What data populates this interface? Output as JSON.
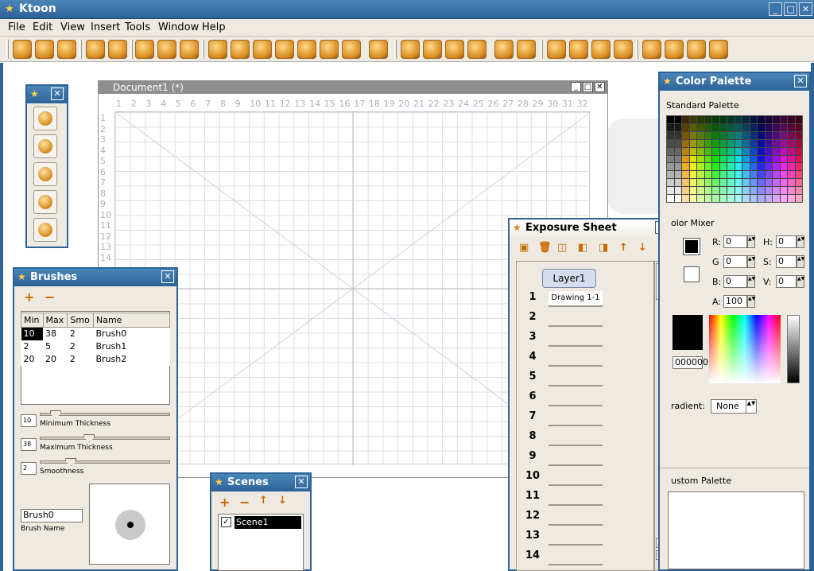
{
  "app": {
    "title": "Ktoon"
  },
  "menu": [
    "File",
    "Edit",
    "View",
    "Insert",
    "Tools",
    "Window",
    "Help"
  ],
  "document": {
    "title": "Document1 (*)",
    "ruler_top": [
      "1",
      "2",
      "3",
      "4",
      "5",
      "6",
      "7",
      "8",
      "9",
      "10",
      "11",
      "12",
      "13",
      "14",
      "15",
      "16",
      "17",
      "18",
      "19",
      "20",
      "21",
      "22",
      "23",
      "24",
      "25",
      "26",
      "27",
      "28",
      "29",
      "30",
      "31",
      "32"
    ],
    "ruler_left": [
      "1",
      "2",
      "3",
      "4",
      "5",
      "6",
      "7",
      "8",
      "9",
      "10",
      "11",
      "12",
      "13",
      "14"
    ]
  },
  "brushes": {
    "title": "Brushes",
    "columns": [
      "Min",
      "Max",
      "Smo",
      "Name"
    ],
    "rows": [
      [
        "10",
        "38",
        "2",
        "Brush0"
      ],
      [
        "2",
        "5",
        "2",
        "Brush1"
      ],
      [
        "20",
        "20",
        "2",
        "Brush2"
      ]
    ],
    "min_value": "10",
    "min_label": "Minimum Thickness",
    "min_level": 0.12,
    "max_value": "38",
    "max_label": "Maximum Thickness",
    "max_level": 0.38,
    "smo_value": "2",
    "smo_label": "Smoothness",
    "smo_level": 0.24,
    "name_value": "Brush0",
    "name_label": "Brush Name"
  },
  "scenes": {
    "title": "Scenes",
    "items": [
      "Scene1"
    ]
  },
  "exposure": {
    "title": "Exposure Sheet",
    "layer": "Layer1",
    "frames": [
      "1",
      "2",
      "3",
      "4",
      "5",
      "6",
      "7",
      "8",
      "9",
      "10",
      "11",
      "12",
      "13",
      "14"
    ],
    "first_cell": "Drawing 1-1"
  },
  "palette": {
    "title": "Color Palette",
    "standard_label": "Standard Palette",
    "mixer_label": "olor Mixer",
    "r_label": "R:",
    "r": "0",
    "g_label": "G",
    "g": "0",
    "b_label": "B:",
    "b": "0",
    "h_label": "H:",
    "h": "0",
    "s_label": "S:",
    "s": "0",
    "v_label": "V:",
    "v": "0",
    "a_label": "A:",
    "a": "100",
    "hex": "000000",
    "gradient_label": "radient:",
    "gradient_value": "None",
    "custom_label": "ustom Palette"
  },
  "colors": {
    "title_blue": "#2d6298",
    "panel_bg": "#eeeae1",
    "accent_orange": "#d98a1c"
  }
}
